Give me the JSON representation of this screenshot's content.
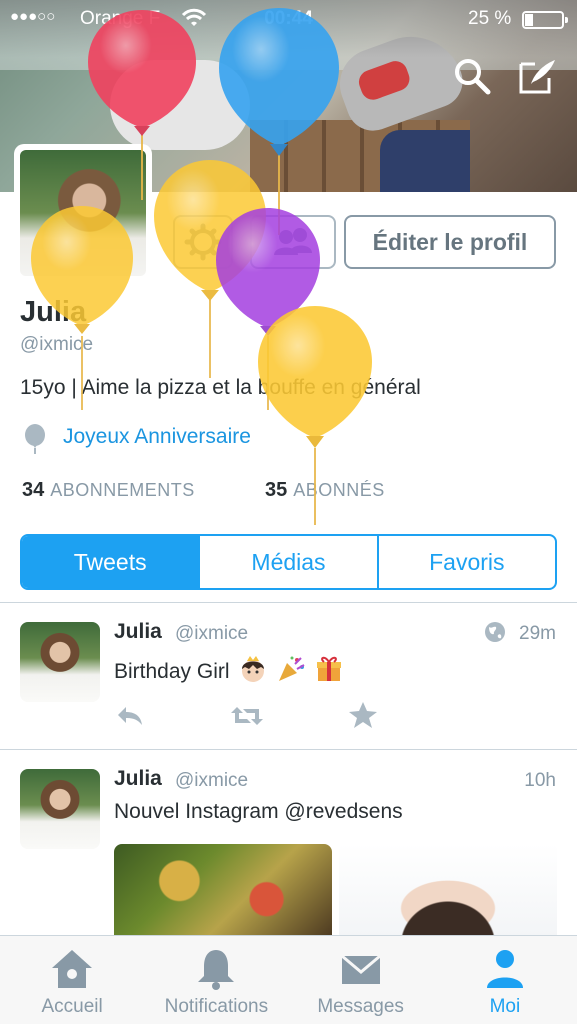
{
  "status_bar": {
    "signal": "●●●○○",
    "carrier": "Orange F",
    "time": "00:44",
    "battery": "25 %"
  },
  "profile": {
    "edit_button": "Éditer le profil",
    "name": "Julia",
    "handle": "@ixmice",
    "bio": "15yo | Aime la pizza et la bouffe en général",
    "special_label": "Joyeux Anniversaire",
    "following_count": "34",
    "following_label": "ABONNEMENTS",
    "followers_count": "35",
    "followers_label": "ABONNÉS"
  },
  "tabs": [
    {
      "label": "Tweets"
    },
    {
      "label": "Médias"
    },
    {
      "label": "Favoris"
    }
  ],
  "tweets": [
    {
      "name": "Julia",
      "handle": "@ixmice",
      "time": "29m",
      "text": "Birthday Girl",
      "emojis": [
        "princess-emoji",
        "party-popper-emoji",
        "gift-emoji"
      ]
    },
    {
      "name": "Julia",
      "handle": "@ixmice",
      "time": "10h",
      "text": "Nouvel Instagram @revedsens"
    }
  ],
  "tab_bar": [
    {
      "label": "Accueil",
      "icon": "home-icon"
    },
    {
      "label": "Notifications",
      "icon": "bell-icon"
    },
    {
      "label": "Messages",
      "icon": "envelope-icon"
    },
    {
      "label": "Moi",
      "icon": "person-icon",
      "active": true
    }
  ],
  "colors": {
    "accent": "#1da1f2",
    "balloon_red": "#f0425f",
    "balloon_blue": "#36a3f0",
    "balloon_yellow": "#fcc934",
    "balloon_purple": "#a43fe0"
  }
}
